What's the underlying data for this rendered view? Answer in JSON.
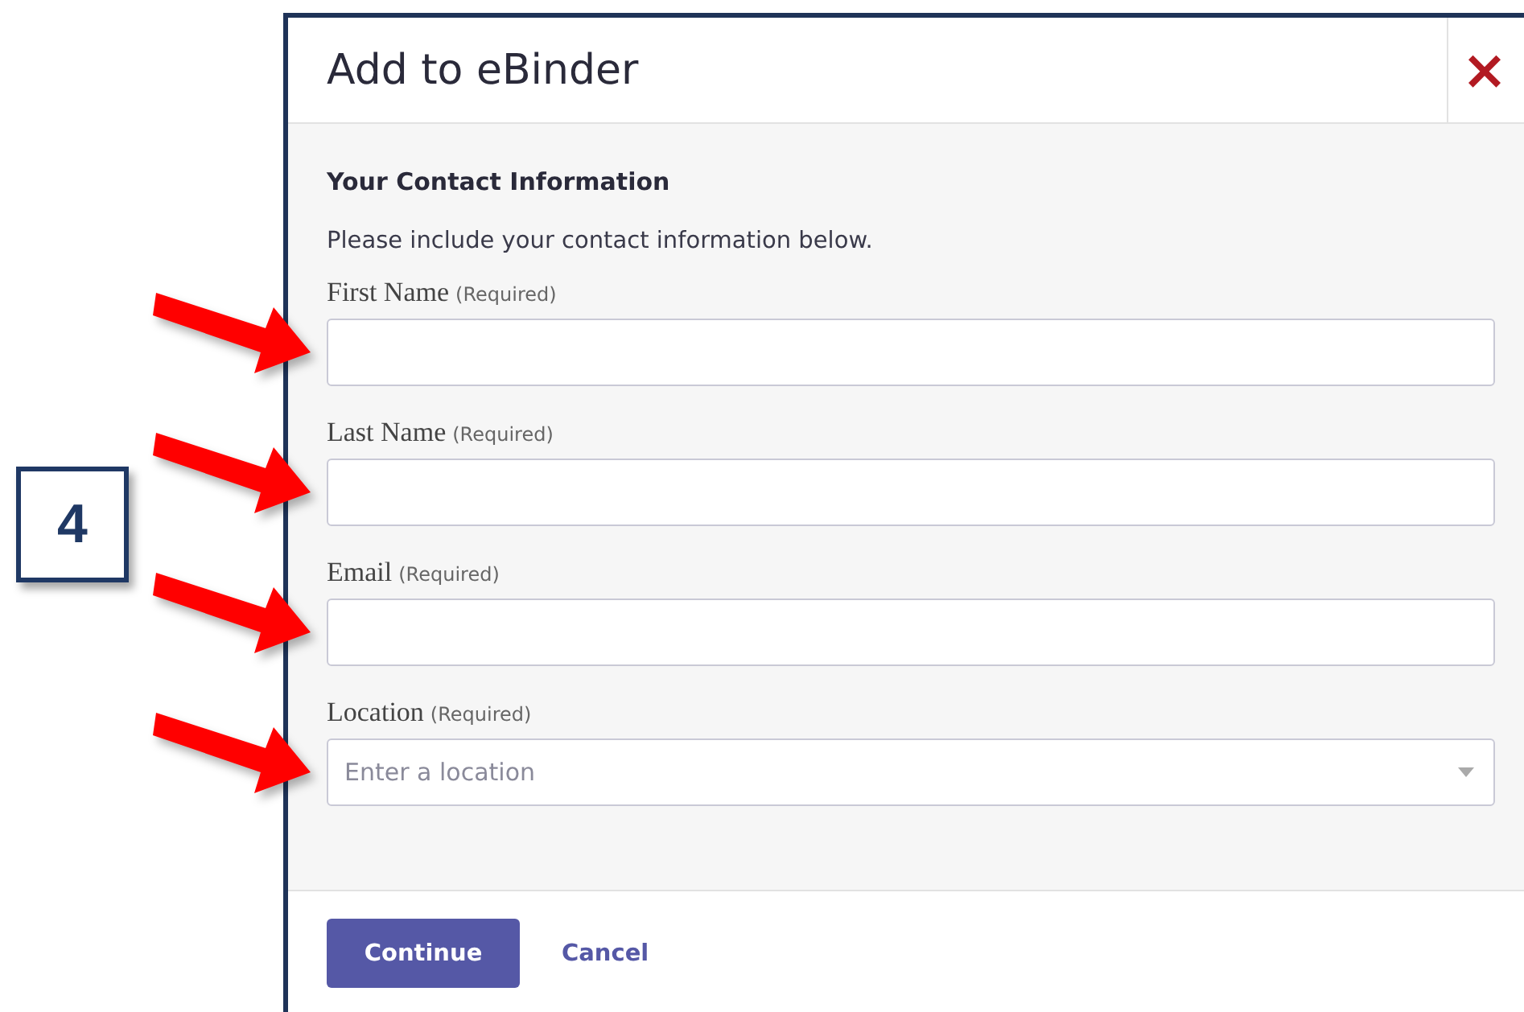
{
  "step_badge": "4",
  "dialog": {
    "title": "Add to eBinder",
    "close": "×",
    "section_heading": "Your Contact Information",
    "intro": "Please include your contact information below.",
    "fields": [
      {
        "kind": "text",
        "label": "First Name",
        "note": "(Required)",
        "marked": true
      },
      {
        "kind": "text",
        "label": "Last Name",
        "note": "(Required)",
        "marked": true
      },
      {
        "kind": "text",
        "label": "Email",
        "note": "(Required)",
        "marked": true
      },
      {
        "kind": "select",
        "label": "Location",
        "note": "(Required)",
        "placeholder": "Enter a location",
        "marked": true
      }
    ],
    "buttons": [
      {
        "kind": "primary",
        "label": "Continue"
      },
      {
        "kind": "link",
        "label": "Cancel"
      }
    ]
  }
}
